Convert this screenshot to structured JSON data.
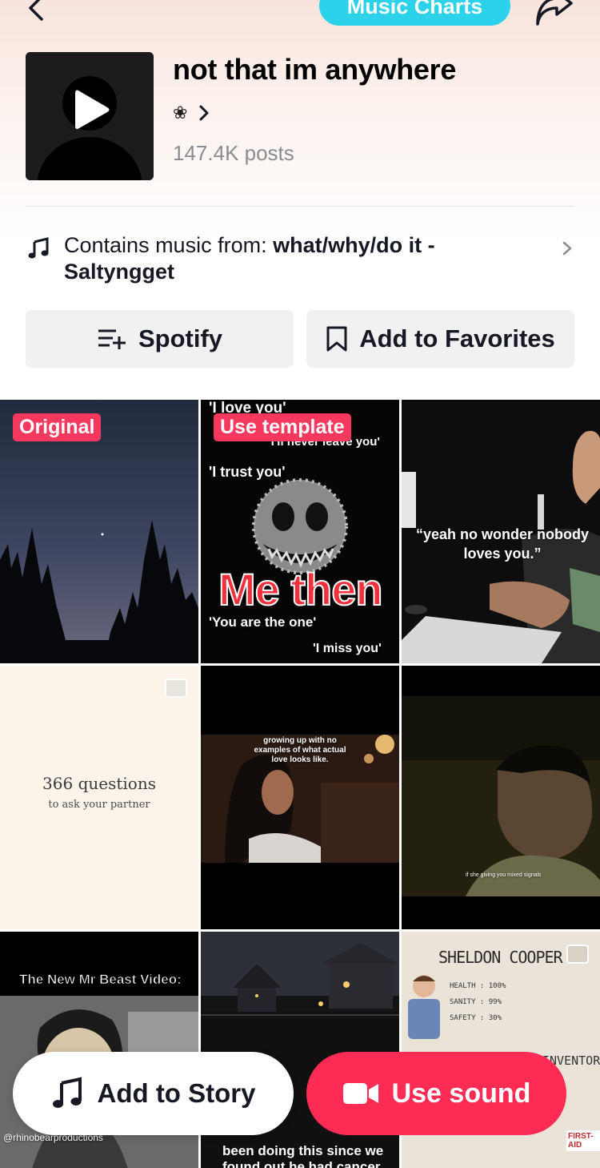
{
  "header": {
    "chip_label": "Music Charts"
  },
  "sound": {
    "title": "not that im anywhere",
    "artist_symbol": "❀",
    "posts": "147.4K posts",
    "contains_prefix": "Contains music from: ",
    "contains_track": "what/why/do it - Saltyngget"
  },
  "actions": {
    "spotify_label": "Spotify",
    "favorites_label": "Add to Favorites"
  },
  "grid": {
    "tile1_badge": "Original",
    "tile2_badge": "Use template",
    "tile2_lines": [
      "'I love you'",
      "'I'll never leave you'",
      "'I trust you'",
      "Me then",
      "'You are the one'",
      "'I miss you'"
    ],
    "tile3_caption": "“yeah no wonder nobody loves you.”",
    "tile4_title": "366 questions",
    "tile4_sub": "to ask your partner",
    "tile5_caption": "growing up with no examples of what actual love looks like.",
    "tile6_caption": "if she giving you mixed signals",
    "tile7_caption": "The New Mr Beast Video:",
    "tile7_handle": "@rhinobearproductions",
    "tile8_caption": "been doing this since we found out he had cancer",
    "tile9_title": "SHELDON COOPER",
    "tile9_stats": [
      "HEALTH : 100%",
      "SANITY : 99%",
      "SAFETY : 30%"
    ],
    "tile9_footer": "INVENTORY",
    "tile9_kit": "FIRST-AID"
  },
  "bottom": {
    "story_label": "Add to Story",
    "use_sound_label": "Use sound"
  },
  "colors": {
    "accent_red": "#fe2c55",
    "chip_cyan": "#2bd2ea",
    "badge_red": "#f5385d"
  }
}
